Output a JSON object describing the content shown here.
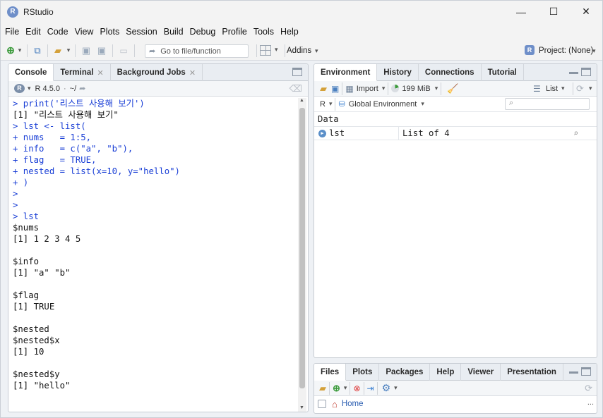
{
  "app": {
    "title": "RStudio",
    "logo_letter": "R"
  },
  "window_controls": {
    "minimize": "—",
    "maximize": "☐",
    "close": "✕"
  },
  "menu": [
    "File",
    "Edit",
    "Code",
    "View",
    "Plots",
    "Session",
    "Build",
    "Debug",
    "Profile",
    "Tools",
    "Help"
  ],
  "toolbar": {
    "goto_placeholder": "Go to file/function",
    "addins": "Addins",
    "project": "Project: (None)"
  },
  "left_pane": {
    "tabs": [
      {
        "label": "Console",
        "closable": false
      },
      {
        "label": "Terminal",
        "closable": true
      },
      {
        "label": "Background Jobs",
        "closable": true
      }
    ],
    "r_version": "R 4.5.0",
    "path": "~/",
    "console_lines": [
      {
        "text": "> print('리스트 사용해 보기')",
        "kind": "cmd"
      },
      {
        "text": "[1] \"리스트 사용해 보기\"",
        "kind": "out"
      },
      {
        "text": "> lst <- list(",
        "kind": "cmd"
      },
      {
        "text": "+ nums   = 1:5,",
        "kind": "cmd"
      },
      {
        "text": "+ info   = c(\"a\", \"b\"),",
        "kind": "cmd"
      },
      {
        "text": "+ flag   = TRUE,",
        "kind": "cmd"
      },
      {
        "text": "+ nested = list(x=10, y=\"hello\")",
        "kind": "cmd"
      },
      {
        "text": "+ )",
        "kind": "cmd"
      },
      {
        "text": ">",
        "kind": "cmd"
      },
      {
        "text": ">",
        "kind": "cmd"
      },
      {
        "text": "> lst",
        "kind": "cmd"
      },
      {
        "text": "$nums",
        "kind": "out"
      },
      {
        "text": "[1] 1 2 3 4 5",
        "kind": "out"
      },
      {
        "text": "",
        "kind": "out"
      },
      {
        "text": "$info",
        "kind": "out"
      },
      {
        "text": "[1] \"a\" \"b\"",
        "kind": "out"
      },
      {
        "text": "",
        "kind": "out"
      },
      {
        "text": "$flag",
        "kind": "out"
      },
      {
        "text": "[1] TRUE",
        "kind": "out"
      },
      {
        "text": "",
        "kind": "out"
      },
      {
        "text": "$nested",
        "kind": "out"
      },
      {
        "text": "$nested$x",
        "kind": "out"
      },
      {
        "text": "[1] 10",
        "kind": "out"
      },
      {
        "text": "",
        "kind": "out"
      },
      {
        "text": "$nested$y",
        "kind": "out"
      },
      {
        "text": "[1] \"hello\"",
        "kind": "out"
      }
    ]
  },
  "env_pane": {
    "tabs": [
      "Environment",
      "History",
      "Connections",
      "Tutorial"
    ],
    "import_label": "Import",
    "memory": "199 MiB",
    "view_mode": "List",
    "language": "R",
    "scope": "Global Environment",
    "section": "Data",
    "rows": [
      {
        "name": "lst",
        "value": "List of  4"
      }
    ]
  },
  "files_pane": {
    "tabs": [
      "Files",
      "Plots",
      "Packages",
      "Help",
      "Viewer",
      "Presentation"
    ],
    "home_label": "Home",
    "more": "..."
  }
}
